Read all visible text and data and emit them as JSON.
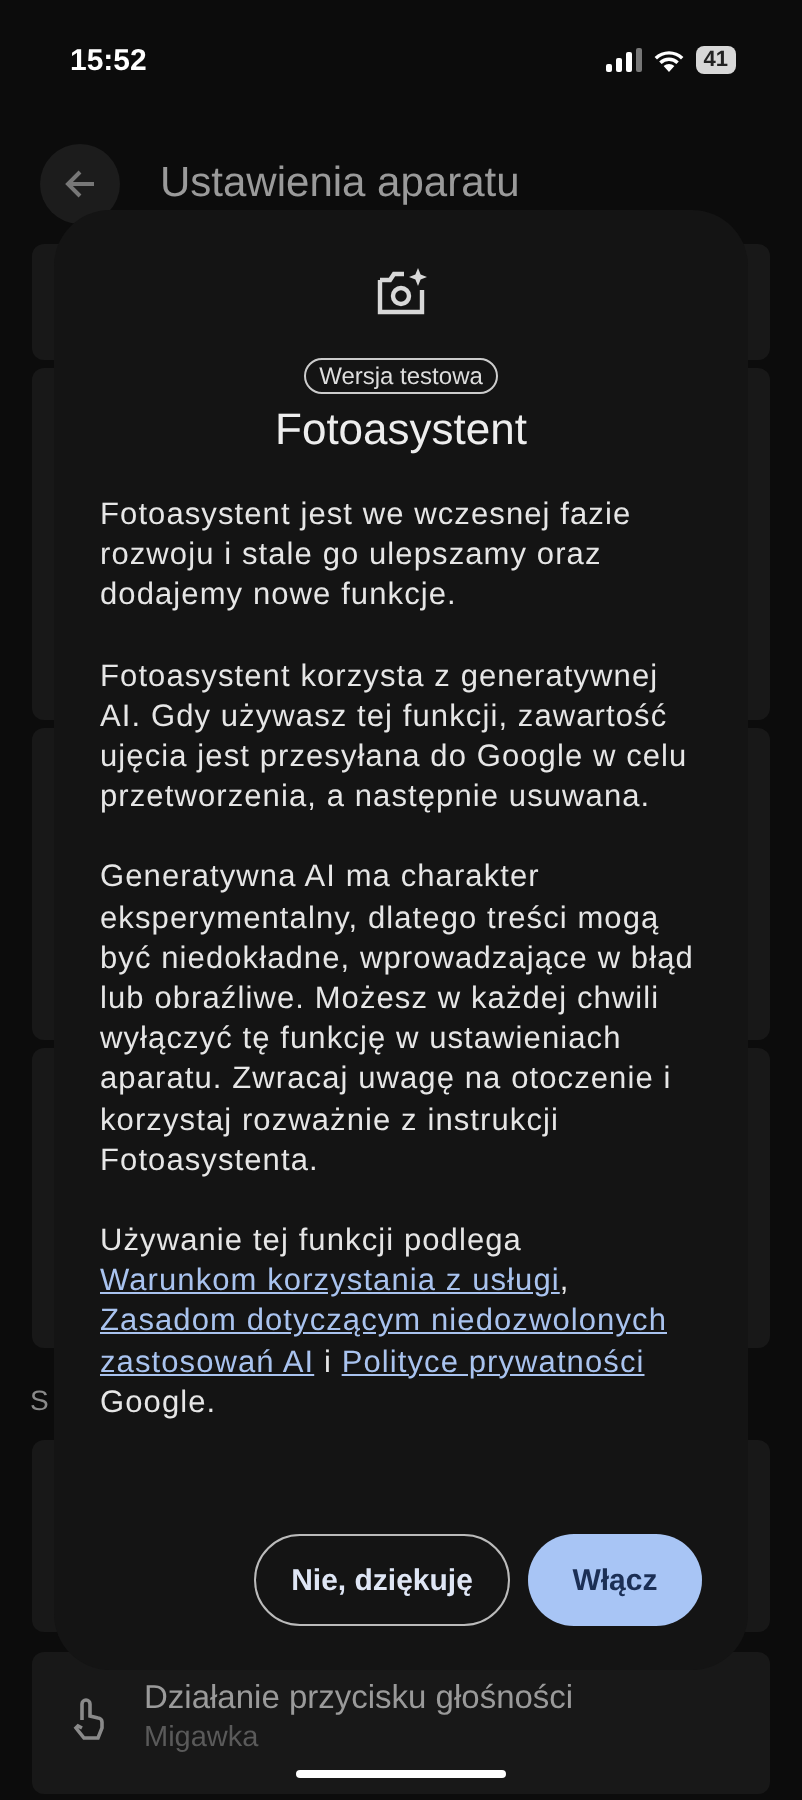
{
  "status_bar": {
    "time": "15:52",
    "battery": "41"
  },
  "header": {
    "title": "Ustawienia aparatu"
  },
  "background": {
    "section_label": "S",
    "bottom_item": {
      "title": "Działanie przycisku głośności",
      "subtitle": "Migawka"
    }
  },
  "dialog": {
    "badge": "Wersja testowa",
    "title": "Fotoasystent",
    "paragraphs": [
      [
        {
          "kind": "text",
          "text": "Fotoasystent jest we wczesnej fazie rozwoju i stale go ulepszamy oraz dodajemy nowe funkcje."
        }
      ],
      [
        {
          "kind": "text",
          "text": "Fotoasystent korzysta z generatywnej AI. Gdy używasz tej funkcji, zawartość ujęcia jest przesyłana do Google w celu przetworzenia, a następnie usuwana."
        }
      ],
      [
        {
          "kind": "text",
          "text": "Generatywna AI ma charakter eksperymentalny, dlatego treści mogą być niedokładne, wprowadzające w błąd lub obraźliwe. Możesz w każdej chwili wyłączyć tę funkcję w ustawieniach aparatu. Zwracaj uwagę na otoczenie i korzystaj rozważnie z instrukcji Fotoasystenta."
        }
      ],
      [
        {
          "kind": "text",
          "text": "Używanie tej funkcji podlega "
        },
        {
          "kind": "link",
          "text": "Warunkom korzystania z usługi"
        },
        {
          "kind": "text",
          "text": ", "
        },
        {
          "kind": "link",
          "text": "Zasadom dotyczącym niedozwolonych"
        },
        {
          "kind": "break"
        },
        {
          "kind": "link",
          "text": "zastosowań AI"
        },
        {
          "kind": "text",
          "text": " i "
        },
        {
          "kind": "link",
          "text": "Polityce prywatności"
        },
        {
          "kind": "text",
          "text": " Google."
        }
      ]
    ],
    "buttons": [
      {
        "kind": "outlined",
        "label": "Nie, dziękuję"
      },
      {
        "kind": "filled",
        "label": "Włącz"
      }
    ]
  }
}
